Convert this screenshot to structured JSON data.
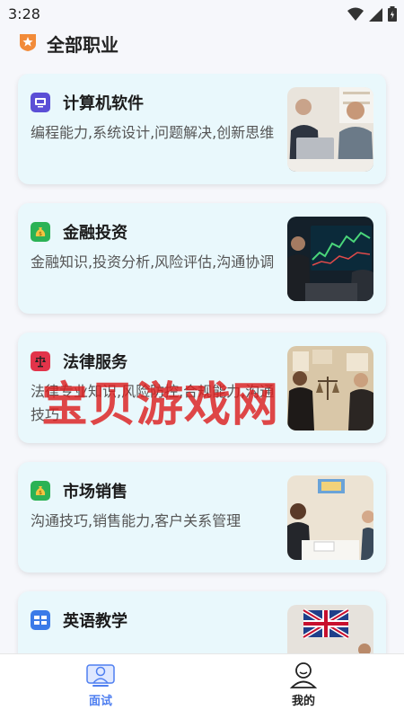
{
  "status": {
    "time": "3:28"
  },
  "header": {
    "title": "全部职业"
  },
  "careers": [
    {
      "title": "计算机软件",
      "desc": "编程能力,系统设计,问题解决,创新思维",
      "icon": "computer-icon",
      "icon_color": "#5b4fd6"
    },
    {
      "title": "金融投资",
      "desc": "金融知识,投资分析,风险评估,沟通协调",
      "icon": "money-bag-icon",
      "icon_color": "#2bb255"
    },
    {
      "title": "法律服务",
      "desc": "法律专业知识,风险防控,合规能力,沟通技巧",
      "icon": "scales-icon",
      "icon_color": "#e2344a"
    },
    {
      "title": "市场销售",
      "desc": "沟通技巧,销售能力,客户关系管理",
      "icon": "money-bag-icon",
      "icon_color": "#2bb255"
    },
    {
      "title": "英语教学",
      "desc": "",
      "icon": "gb-flag-icon",
      "icon_color": "#3b7be8"
    }
  ],
  "watermark": "宝贝游戏网",
  "nav": {
    "interview": "面试",
    "mine": "我的"
  },
  "colors": {
    "accent": "#4f7ff0",
    "card_bg": "#e9f8fc"
  }
}
